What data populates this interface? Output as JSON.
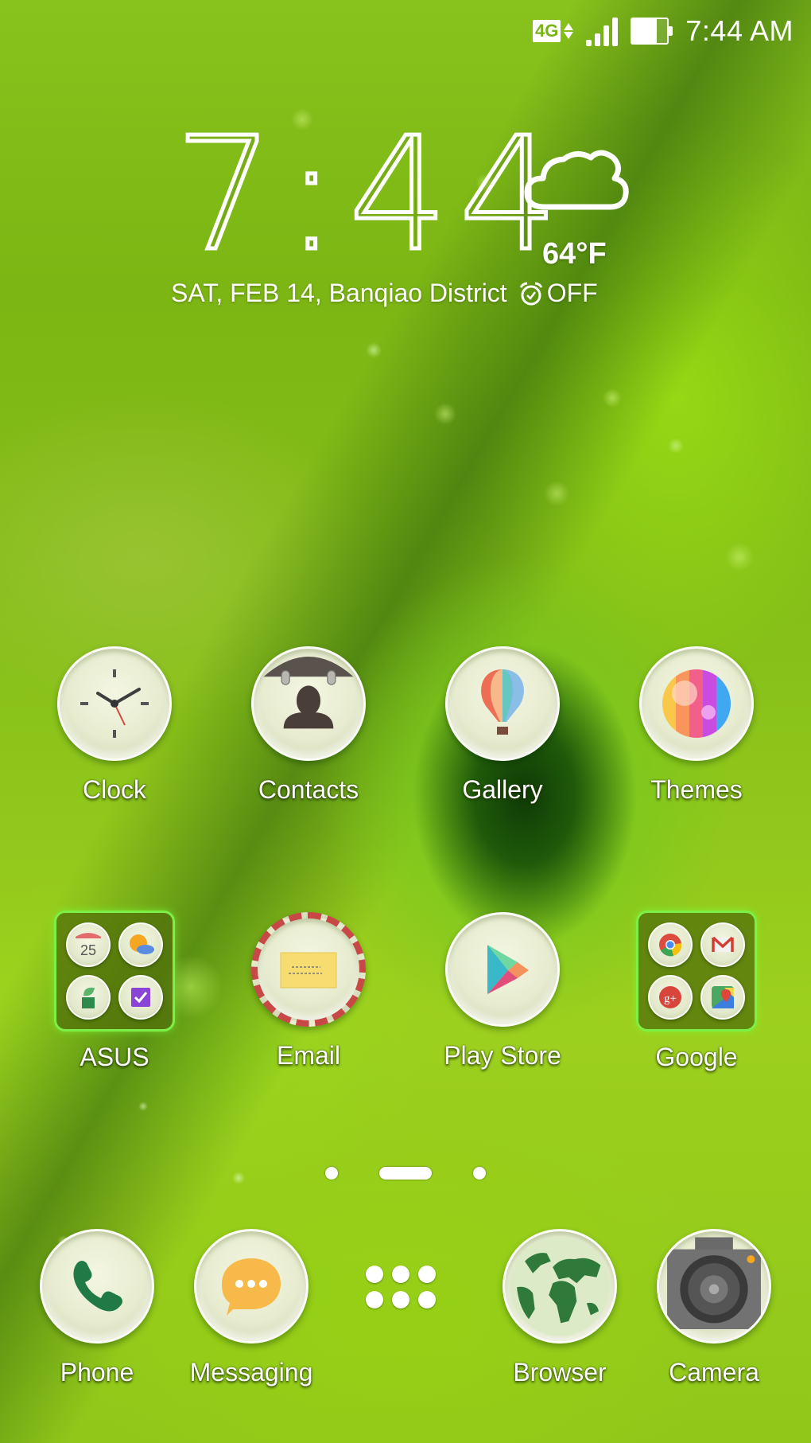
{
  "status_bar": {
    "network_type": "4G",
    "signal_level": 1.0,
    "battery_level": 0.7,
    "time": "7:44 AM",
    "icons": [
      "network-4g-icon",
      "data-arrows-icon",
      "signal-icon",
      "battery-icon"
    ]
  },
  "clock_widget": {
    "time": "7:44",
    "weather_icon": "cloud-icon",
    "temperature": "64°F",
    "date": "SAT, FEB 14, Banqiao District",
    "alarm_icon": "alarm-clock-icon",
    "alarm_status": "OFF"
  },
  "home_apps": [
    {
      "label": "Clock",
      "icon": "clock-icon"
    },
    {
      "label": "Contacts",
      "icon": "contacts-icon"
    },
    {
      "label": "Gallery",
      "icon": "hot-air-balloon-icon"
    },
    {
      "label": "Themes",
      "icon": "themes-palette-icon"
    },
    {
      "label": "ASUS",
      "icon": "folder-icon",
      "folder_items": [
        {
          "name": "calendar-icon",
          "text": "25"
        },
        {
          "name": "weather-icon"
        },
        {
          "name": "power-saver-icon"
        },
        {
          "name": "do-it-later-icon"
        }
      ]
    },
    {
      "label": "Email",
      "icon": "envelope-icon"
    },
    {
      "label": "Play Store",
      "icon": "play-store-icon"
    },
    {
      "label": "Google",
      "icon": "folder-icon",
      "folder_items": [
        {
          "name": "chrome-icon"
        },
        {
          "name": "gmail-icon"
        },
        {
          "name": "google-plus-icon"
        },
        {
          "name": "maps-icon"
        }
      ]
    }
  ],
  "page_indicator": {
    "pages": 3,
    "current": 2
  },
  "dock": [
    {
      "label": "Phone",
      "icon": "phone-icon"
    },
    {
      "label": "Messaging",
      "icon": "messaging-icon"
    },
    {
      "label": "",
      "icon": "all-apps-icon"
    },
    {
      "label": "Browser",
      "icon": "globe-icon"
    },
    {
      "label": "Camera",
      "icon": "camera-icon"
    }
  ],
  "colors": {
    "wallpaper_green": "#8cc41a",
    "folder_border": "#7cf046",
    "text": "#ffffff"
  }
}
